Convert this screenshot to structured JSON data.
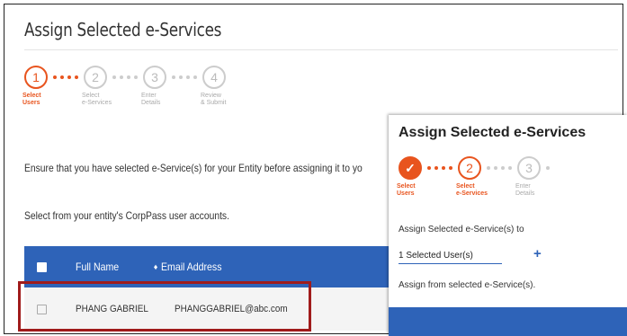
{
  "back_panel": {
    "title": "Assign Selected e-Services",
    "steps": [
      {
        "num": "1",
        "label": "Select\nUsers",
        "state": "active"
      },
      {
        "num": "2",
        "label": "Select\ne-Services",
        "state": "inactive"
      },
      {
        "num": "3",
        "label": "Enter\nDetails",
        "state": "inactive"
      },
      {
        "num": "4",
        "label": "Review\n& Submit",
        "state": "inactive"
      }
    ],
    "notice": "Ensure that you have selected e-Service(s) for your Entity before assigning it to yo",
    "instruction": "Select from your entity's CorpPass user accounts.",
    "table": {
      "headers": {
        "full_name": "Full Name",
        "sort_icon": "♦",
        "email": "Email Address"
      },
      "rows": [
        {
          "full_name": "PHANG GABRIEL",
          "email": "PHANGGABRIEL@abc.com"
        }
      ]
    }
  },
  "front_panel": {
    "title": "Assign Selected e-Services",
    "steps": [
      {
        "num": "✓",
        "label": "Select\nUsers",
        "state": "done"
      },
      {
        "num": "2",
        "label": "Select\ne-Services",
        "state": "active"
      },
      {
        "num": "3",
        "label": "Enter\nDetails",
        "state": "inactive"
      }
    ],
    "assign_to_label": "Assign Selected e-Service(s) to",
    "selected_users": "1 Selected User(s)",
    "add_icon": "+",
    "assign_from_label": "Assign from selected e-Service(s)."
  },
  "colors": {
    "accent": "#e8541e",
    "primary": "#2e63b8",
    "highlight_border": "#a01b1b"
  }
}
